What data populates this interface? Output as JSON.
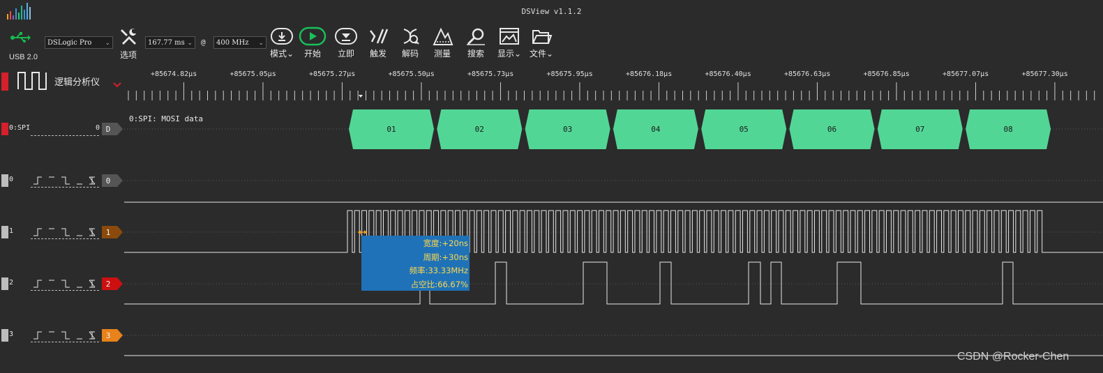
{
  "window": {
    "title": "DSView v1.1.2"
  },
  "toolbar": {
    "usb_label": "USB 2.0",
    "device": "DSLogic Pro",
    "duration": "167.77 ms",
    "at_symbol": "@",
    "sample_rate": "400 MHz",
    "options_label": "选项",
    "mode_label": "模式",
    "start_label": "开始",
    "instant_label": "立即",
    "trigger_label": "触发",
    "decode_label": "解码",
    "measure_label": "测量",
    "search_label": "搜索",
    "display_label": "显示",
    "file_label": "文件",
    "menu_arrow": "⌄"
  },
  "panel": {
    "title": "逻辑分析仪"
  },
  "ruler": {
    "labels": [
      "+85674.82μs",
      "+85675.05μs",
      "+85675.27μs",
      "+85675.50μs",
      "+85675.73μs",
      "+85675.95μs",
      "+85676.18μs",
      "+85676.40μs",
      "+85676.63μs",
      "+85676.85μs",
      "+85677.07μs",
      "+85677.30μs"
    ]
  },
  "channels": [
    {
      "id": "0:SPI",
      "index": "0",
      "tag": "D",
      "color": "#555555"
    },
    {
      "id": "0",
      "tag": "0",
      "color": "#555555"
    },
    {
      "id": "1",
      "tag": "1",
      "color": "#8b4a0b"
    },
    {
      "id": "2",
      "tag": "2",
      "color": "#cc1010"
    },
    {
      "id": "3",
      "tag": "3",
      "color": "#e8821a"
    }
  ],
  "decoder": {
    "row_title": "0:SPI: MOSI data",
    "bytes": [
      "01",
      "02",
      "03",
      "04",
      "05",
      "06",
      "07",
      "08"
    ],
    "color": "#52d696"
  },
  "measurement": {
    "width": "宽度:+20ns",
    "period": "周期:+30ns",
    "frequency": "频率:33.33MHz",
    "duty": "占空比:66.67%"
  },
  "watermark": "CSDN @Rocker-Chen",
  "colors": {
    "background": "#2b2b2b",
    "accent": "#52d696",
    "tooltip": "#1f72b8",
    "marker_red": "#d6202a"
  }
}
